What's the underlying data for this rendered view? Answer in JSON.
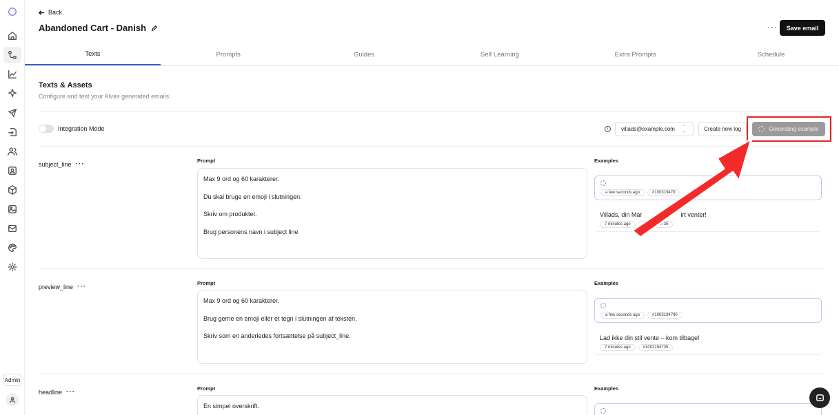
{
  "sidebar": {
    "icons": [
      "logo-icon",
      "home-icon",
      "flow-icon",
      "chart-icon",
      "sparkle-icon",
      "send-icon",
      "import-icon",
      "users-icon",
      "contact-icon",
      "package-icon",
      "image-icon",
      "mail-icon",
      "palette-icon",
      "gear-icon"
    ],
    "admin_label": "Admin"
  },
  "header": {
    "back_label": "Back",
    "title": "Abandoned Cart - Danish",
    "more_label": "···",
    "save_label": "Save email"
  },
  "tabs": [
    {
      "label": "Texts",
      "active": true
    },
    {
      "label": "Prompts"
    },
    {
      "label": "Guides"
    },
    {
      "label": "Self Learning"
    },
    {
      "label": "Extra Prompts"
    },
    {
      "label": "Schedule"
    }
  ],
  "section": {
    "title": "Texts & Assets",
    "subtitle": "Configure and test your Alvas generated emails"
  },
  "controls": {
    "integration_label": "Integration Mode",
    "email_value": "villads@example.com",
    "create_log_label": "Create new log",
    "generating_label": "Generating example"
  },
  "labels": {
    "prompt": "Prompt",
    "examples": "Examples"
  },
  "fields": [
    {
      "name": "subject_line",
      "prompt_lines": [
        "Max 9 ord og 60 karakterer.",
        "Du skal bruge en emoji i slutningen.",
        "Skriv om produktet.",
        "Brug personens navn i subject line"
      ],
      "current": {
        "time": "a few seconds ago",
        "id": "#100319479"
      },
      "past": {
        "text": "Villads, din Mar",
        "text_tail": "irt venter!",
        "time": "7 minutes ago",
        "id": "#1003194735"
      }
    },
    {
      "name": "preview_line",
      "prompt_lines": [
        "Max 9 ord og 60 karakterer.",
        "Brug gerne en emoji eller et tegn i slutningen af teksten.",
        "Skriv som en anderledes fortsættelse på subject_line."
      ],
      "current": {
        "time": "a few seconds ago",
        "id": "#1003194790"
      },
      "past": {
        "text": "Lad ikke din stil vente – kom tilbage!",
        "time": "7 minutes ago",
        "id": "#1003194735"
      }
    },
    {
      "name": "headline",
      "prompt_lines": [
        "En simpel overskrift."
      ]
    }
  ]
}
